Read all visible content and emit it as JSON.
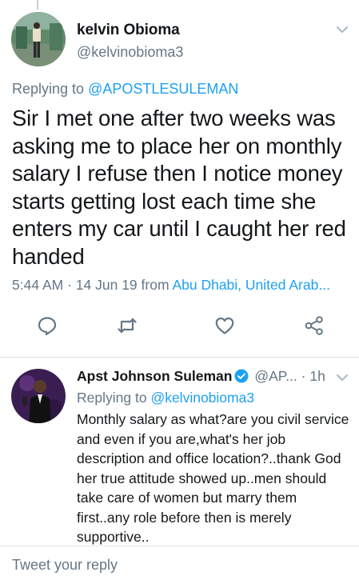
{
  "main_tweet": {
    "author_name": "kelvin Obioma",
    "author_handle": "@kelvinobioma3",
    "replying_prefix": "Replying to",
    "replying_to": "@APOSTLESULEMAN",
    "text": "Sir I met one after two weeks was asking me to place her on monthly salary I refuse then I notice money starts getting lost each time she enters my car until I caught her red handed",
    "time": "5:44 AM",
    "separator": "·",
    "date": "14 Jun 19",
    "from_label": "from",
    "location": "Abu Dhabi, United Arab..."
  },
  "actions": {
    "reply": "reply-icon",
    "retweet": "retweet-icon",
    "like": "heart-icon",
    "share": "share-icon"
  },
  "reply_tweet": {
    "author_name": "Apst Johnson Suleman",
    "author_handle": "@AP...",
    "separator": "·",
    "time_ago": "1h",
    "replying_prefix": "Replying to",
    "replying_to": "@kelvinobioma3",
    "text": "Monthly salary as what?are you civil service and even if you are,what's her job description and office location?..thank God her true attitude showed up..men should take care of women but marry them first..any role before then is merely supportive.."
  },
  "composer": {
    "placeholder": "Tweet your reply"
  },
  "colors": {
    "link": "#1da1f2",
    "secondary_text": "#657786",
    "divider": "#e1e8ed",
    "verified_badge": "#1da1f2"
  }
}
